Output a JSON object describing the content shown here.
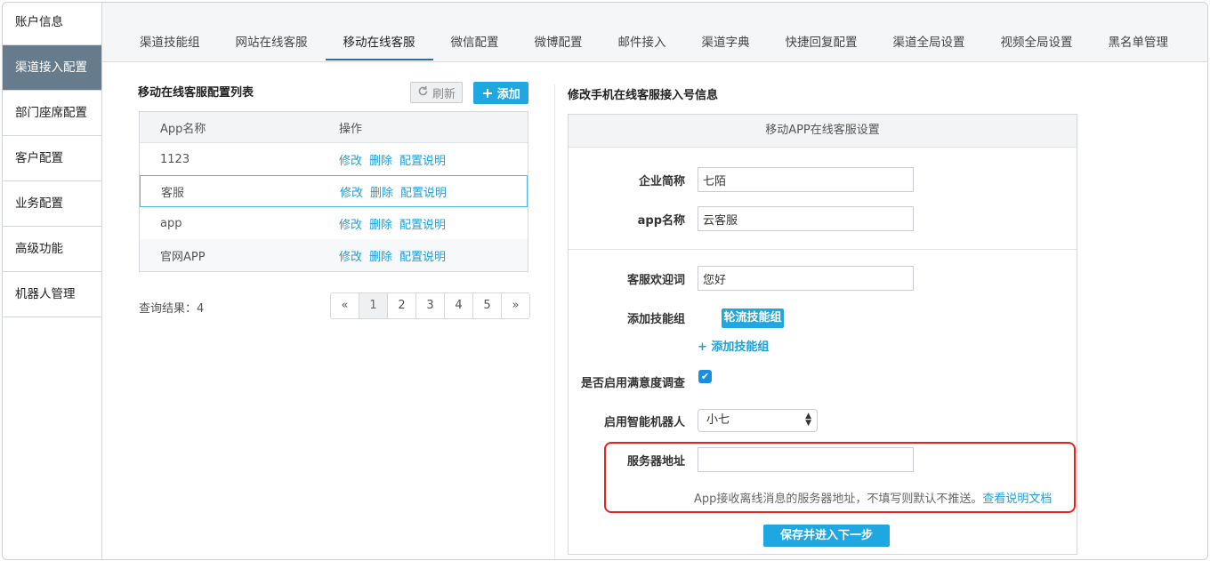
{
  "sidebar": {
    "items": [
      {
        "label": "账户信息"
      },
      {
        "label": "渠道接入配置"
      },
      {
        "label": "部门座席配置"
      },
      {
        "label": "客户配置"
      },
      {
        "label": "业务配置"
      },
      {
        "label": "高级功能"
      },
      {
        "label": "机器人管理"
      }
    ]
  },
  "tabs": [
    {
      "label": "渠道技能组"
    },
    {
      "label": "网站在线客服"
    },
    {
      "label": "移动在线客服"
    },
    {
      "label": "微信配置"
    },
    {
      "label": "微博配置"
    },
    {
      "label": "邮件接入"
    },
    {
      "label": "渠道字典"
    },
    {
      "label": "快捷回复配置"
    },
    {
      "label": "渠道全局设置"
    },
    {
      "label": "视频全局设置"
    },
    {
      "label": "黑名单管理"
    }
  ],
  "list": {
    "title": "移动在线客服配置列表",
    "refresh_label": "刷新",
    "add_label": "添加",
    "headers": {
      "name": "App名称",
      "actions": "操作"
    },
    "rows": [
      {
        "name": "1123"
      },
      {
        "name": "客服"
      },
      {
        "name": "app"
      },
      {
        "name": "官网APP"
      }
    ],
    "action_edit": "修改",
    "action_delete": "删除",
    "action_help": "配置说明",
    "count_label": "查询结果：4",
    "pagination": [
      "«",
      "1",
      "2",
      "3",
      "4",
      "5",
      "»"
    ]
  },
  "form": {
    "title": "修改手机在线客服接入号信息",
    "panel_header": "移动APP在线客服设置",
    "company_label": "企业简称",
    "company_value": "七陌",
    "app_label": "app名称",
    "app_value": "云客服",
    "welcome_label": "客服欢迎词",
    "welcome_value": "您好",
    "group_label": "添加技能组",
    "group_pill": "轮流技能组",
    "add_group_link": "添加技能组",
    "survey_label": "是否启用满意度调查",
    "robot_label": "启用智能机器人",
    "robot_value": "小七",
    "server_label": "服务器地址",
    "server_value": "",
    "help_text": "App接收离线消息的服务器地址，不填写则默认不推送。",
    "help_link": "查看说明文档",
    "save_label": "保存并进入下一步"
  },
  "colors": {
    "accent": "#1ea7e0",
    "sidebar_active": "#667b8c",
    "highlight": "#e8231c"
  }
}
